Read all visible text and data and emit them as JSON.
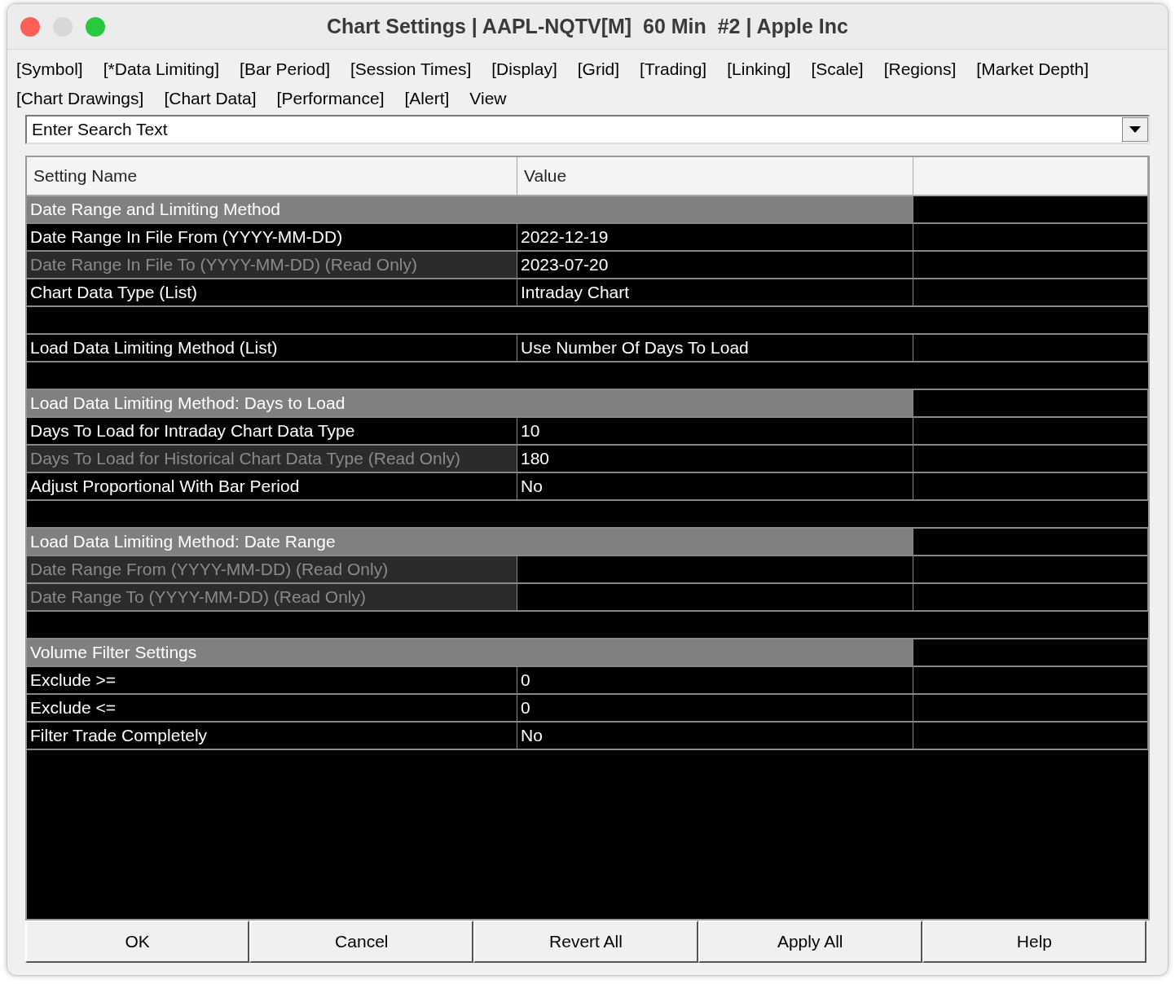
{
  "window": {
    "title": "Chart Settings | AAPL-NQTV[M]  60 Min  #2 | Apple Inc"
  },
  "tabs": [
    {
      "label": "[Symbol]"
    },
    {
      "label": "[*Data Limiting]"
    },
    {
      "label": "[Bar Period]"
    },
    {
      "label": "[Session Times]"
    },
    {
      "label": "[Display]"
    },
    {
      "label": "[Grid]"
    },
    {
      "label": "[Trading]"
    },
    {
      "label": "[Linking]"
    },
    {
      "label": "[Scale]"
    },
    {
      "label": "[Regions]"
    },
    {
      "label": "[Market Depth]"
    },
    {
      "label": "[Chart Drawings]"
    },
    {
      "label": "[Chart Data]"
    },
    {
      "label": "[Performance]"
    },
    {
      "label": "[Alert]"
    },
    {
      "label": "View"
    }
  ],
  "search": {
    "placeholder": "Enter Search Text"
  },
  "table": {
    "columns": [
      "Setting Name",
      "Value"
    ],
    "rows": [
      {
        "kind": "section",
        "name": "Date Range and Limiting Method"
      },
      {
        "kind": "setting",
        "name": "Date Range In File From (YYYY-MM-DD)",
        "value": "2022-12-19",
        "read_only": false
      },
      {
        "kind": "setting",
        "name": "Date Range In File To (YYYY-MM-DD) (Read Only)",
        "value": "2023-07-20",
        "read_only": true
      },
      {
        "kind": "setting",
        "name": "Chart Data Type (List)",
        "value": "Intraday Chart",
        "read_only": false
      },
      {
        "kind": "blank"
      },
      {
        "kind": "setting",
        "name": "Load Data Limiting Method (List)",
        "value": "Use Number Of Days To Load",
        "read_only": false
      },
      {
        "kind": "blank"
      },
      {
        "kind": "section",
        "name": "Load Data Limiting Method: Days to Load"
      },
      {
        "kind": "setting",
        "name": "Days To Load for Intraday Chart Data Type",
        "value": "10",
        "read_only": false
      },
      {
        "kind": "setting",
        "name": "Days To Load for Historical Chart Data Type (Read Only)",
        "value": "180",
        "read_only": true
      },
      {
        "kind": "setting",
        "name": "Adjust Proportional With Bar Period",
        "value": "No",
        "read_only": false
      },
      {
        "kind": "blank"
      },
      {
        "kind": "section",
        "name": "Load Data Limiting Method: Date Range"
      },
      {
        "kind": "setting",
        "name": "Date Range From (YYYY-MM-DD) (Read Only)",
        "read_only": true
      },
      {
        "kind": "setting",
        "name": "Date Range To (YYYY-MM-DD) (Read Only)",
        "read_only": true
      },
      {
        "kind": "blank"
      },
      {
        "kind": "section",
        "name": "Volume Filter Settings"
      },
      {
        "kind": "setting",
        "name": "Exclude >=",
        "value": "0",
        "read_only": false
      },
      {
        "kind": "setting",
        "name": "Exclude <=",
        "value": "0",
        "read_only": false
      },
      {
        "kind": "setting",
        "name": "Filter Trade Completely",
        "value": "No",
        "read_only": false
      }
    ]
  },
  "buttons": [
    "OK",
    "Cancel",
    "Revert All",
    "Apply All",
    "Help"
  ]
}
